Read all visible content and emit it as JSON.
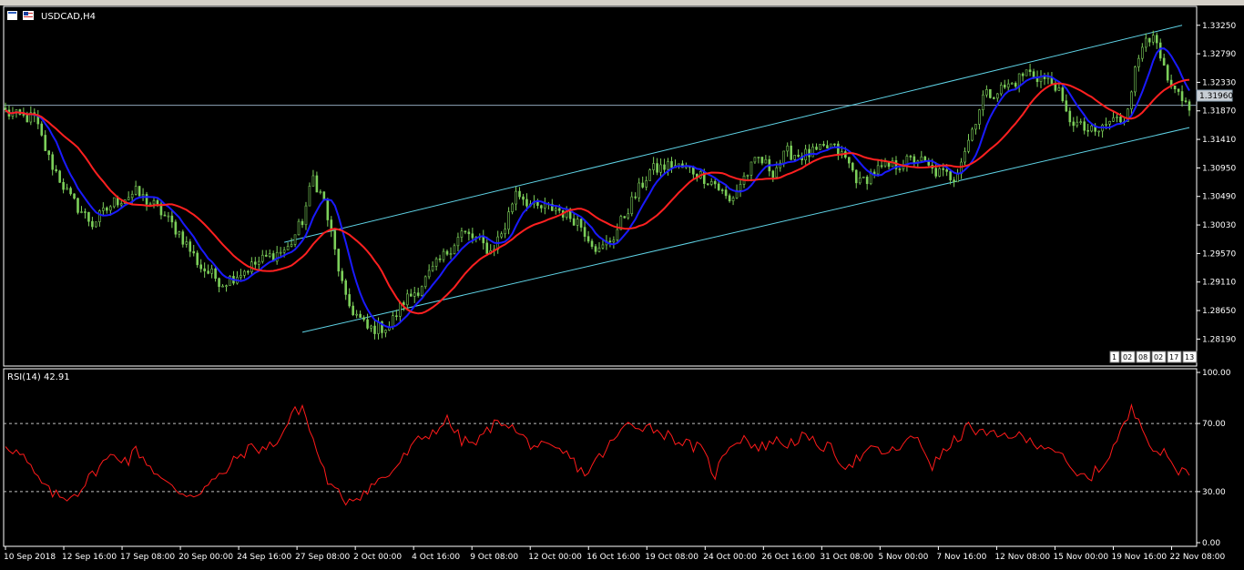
{
  "window": {
    "symbol_title": "USDCAD,H4",
    "current_price": "1.31960"
  },
  "indicator": {
    "title": "RSI(14) 42.91",
    "levels": [
      "100.00",
      "70.00",
      "30.00",
      "0.00"
    ]
  },
  "navigation_tabs": [
    "1",
    "02",
    "08",
    "02",
    "17",
    "13"
  ],
  "colors": {
    "background": "#000000",
    "candles": "#7ccf5a",
    "ma_fast": "#1a1aff",
    "ma_slow": "#ff2020",
    "channel": "#5fd3e6",
    "rsi": "#ff1a1a",
    "price_line": "#8fa6b8"
  },
  "chart_data": [
    {
      "type": "candlestick",
      "title": "USDCAD,H4",
      "y_ticks": [
        "1.33250",
        "1.32790",
        "1.32330",
        "1.31870",
        "1.31410",
        "1.30950",
        "1.30490",
        "1.30030",
        "1.29570",
        "1.29110",
        "1.28650",
        "1.28190"
      ],
      "ylim": [
        1.2777,
        1.3354
      ],
      "x_ticks": [
        "10 Sep 2018",
        "12 Sep 16:00",
        "17 Sep 08:00",
        "20 Sep 00:00",
        "24 Sep 16:00",
        "27 Sep 08:00",
        "2 Oct 00:00",
        "4 Oct 16:00",
        "9 Oct 08:00",
        "12 Oct 00:00",
        "16 Oct 16:00",
        "19 Oct 08:00",
        "24 Oct 00:00",
        "26 Oct 16:00",
        "31 Oct 08:00",
        "5 Nov 00:00",
        "7 Nov 16:00",
        "12 Nov 08:00",
        "15 Nov 00:00",
        "19 Nov 16:00",
        "22 Nov 08:00"
      ],
      "current_price": 1.3196,
      "price_anchors": [
        [
          0,
          1.3185
        ],
        [
          3,
          1.3178
        ],
        [
          8,
          1.3175
        ],
        [
          12,
          1.311
        ],
        [
          18,
          1.3045
        ],
        [
          24,
          1.3005
        ],
        [
          30,
          1.304
        ],
        [
          36,
          1.3055
        ],
        [
          42,
          1.303
        ],
        [
          48,
          1.299
        ],
        [
          54,
          1.2935
        ],
        [
          60,
          1.291
        ],
        [
          66,
          1.293
        ],
        [
          72,
          1.295
        ],
        [
          78,
          1.2965
        ],
        [
          82,
          1.301
        ],
        [
          85,
          1.308
        ],
        [
          88,
          1.304
        ],
        [
          91,
          1.296
        ],
        [
          94,
          1.288
        ],
        [
          100,
          1.2835
        ],
        [
          106,
          1.284
        ],
        [
          110,
          1.288
        ],
        [
          114,
          1.29
        ],
        [
          118,
          1.293
        ],
        [
          122,
          1.296
        ],
        [
          126,
          1.299
        ],
        [
          130,
          1.298
        ],
        [
          134,
          1.296
        ],
        [
          138,
          1.3
        ],
        [
          141,
          1.306
        ],
        [
          146,
          1.303
        ],
        [
          152,
          1.303
        ],
        [
          158,
          1.301
        ],
        [
          164,
          1.296
        ],
        [
          168,
          1.2985
        ],
        [
          172,
          1.303
        ],
        [
          178,
          1.309
        ],
        [
          184,
          1.31
        ],
        [
          190,
          1.309
        ],
        [
          196,
          1.307
        ],
        [
          200,
          1.304
        ],
        [
          204,
          1.308
        ],
        [
          208,
          1.311
        ],
        [
          212,
          1.309
        ],
        [
          216,
          1.312
        ],
        [
          220,
          1.3115
        ],
        [
          224,
          1.312
        ],
        [
          228,
          1.313
        ],
        [
          232,
          1.311
        ],
        [
          236,
          1.307
        ],
        [
          240,
          1.309
        ],
        [
          246,
          1.31
        ],
        [
          252,
          1.311
        ],
        [
          256,
          1.309
        ],
        [
          262,
          1.308
        ],
        [
          266,
          1.314
        ],
        [
          270,
          1.321
        ],
        [
          274,
          1.322
        ],
        [
          278,
          1.323
        ],
        [
          282,
          1.325
        ],
        [
          286,
          1.324
        ],
        [
          290,
          1.323
        ],
        [
          293,
          1.318
        ],
        [
          297,
          1.316
        ],
        [
          301,
          1.315
        ],
        [
          305,
          1.317
        ],
        [
          309,
          1.3175
        ],
        [
          312,
          1.325
        ],
        [
          315,
          1.3315
        ],
        [
          318,
          1.329
        ],
        [
          321,
          1.323
        ],
        [
          325,
          1.32
        ],
        [
          327,
          1.3196
        ]
      ],
      "series": [
        {
          "name": "",
          "kind": "moving_average",
          "period": 8,
          "color": "#1a1aff"
        },
        {
          "name": "",
          "kind": "moving_average",
          "period": 21,
          "color": "#ff2020"
        }
      ],
      "channel": {
        "upper": {
          "start_bar": 77,
          "start_price": 1.2975,
          "end_bar": 325,
          "end_price": 1.3325
        },
        "lower": {
          "start_bar": 82,
          "start_price": 1.283,
          "end_bar": 327,
          "end_price": 1.316
        }
      }
    },
    {
      "type": "line",
      "title": "RSI(14) 42.91",
      "ylim": [
        0,
        100
      ],
      "y_ticks": [
        "100.00",
        "70.00",
        "30.00",
        "0.00"
      ],
      "levels": [
        70,
        30
      ],
      "series": [
        {
          "name": "",
          "color": "#ff1a1a",
          "anchors": [
            [
              0,
              58
            ],
            [
              5,
              50
            ],
            [
              8,
              40
            ],
            [
              12,
              30
            ],
            [
              16,
              26
            ],
            [
              20,
              30
            ],
            [
              26,
              45
            ],
            [
              30,
              52
            ],
            [
              34,
              48
            ],
            [
              36,
              55
            ],
            [
              40,
              45
            ],
            [
              44,
              35
            ],
            [
              48,
              30
            ],
            [
              52,
              28
            ],
            [
              56,
              34
            ],
            [
              60,
              40
            ],
            [
              64,
              50
            ],
            [
              68,
              56
            ],
            [
              72,
              55
            ],
            [
              76,
              62
            ],
            [
              79,
              75
            ],
            [
              82,
              80
            ],
            [
              85,
              60
            ],
            [
              88,
              42
            ],
            [
              90,
              32
            ],
            [
              94,
              25
            ],
            [
              98,
              28
            ],
            [
              102,
              35
            ],
            [
              106,
              40
            ],
            [
              110,
              50
            ],
            [
              114,
              60
            ],
            [
              118,
              65
            ],
            [
              122,
              72
            ],
            [
              126,
              60
            ],
            [
              130,
              58
            ],
            [
              134,
              68
            ],
            [
              138,
              72
            ],
            [
              141,
              65
            ],
            [
              145,
              58
            ],
            [
              150,
              55
            ],
            [
              155,
              52
            ],
            [
              160,
              40
            ],
            [
              164,
              50
            ],
            [
              168,
              60
            ],
            [
              172,
              70
            ],
            [
              178,
              68
            ],
            [
              184,
              62
            ],
            [
              188,
              58
            ],
            [
              192,
              55
            ],
            [
              196,
              40
            ],
            [
              200,
              58
            ],
            [
              204,
              62
            ],
            [
              208,
              55
            ],
            [
              212,
              60
            ],
            [
              216,
              58
            ],
            [
              220,
              62
            ],
            [
              224,
              58
            ],
            [
              228,
              55
            ],
            [
              232,
              45
            ],
            [
              236,
              50
            ],
            [
              240,
              55
            ],
            [
              244,
              52
            ],
            [
              248,
              58
            ],
            [
              252,
              62
            ],
            [
              256,
              45
            ],
            [
              260,
              55
            ],
            [
              266,
              68
            ],
            [
              270,
              64
            ],
            [
              274,
              62
            ],
            [
              278,
              64
            ],
            [
              282,
              60
            ],
            [
              286,
              58
            ],
            [
              290,
              55
            ],
            [
              295,
              40
            ],
            [
              299,
              38
            ],
            [
              303,
              45
            ],
            [
              307,
              60
            ],
            [
              311,
              78
            ],
            [
              314,
              70
            ],
            [
              317,
              55
            ],
            [
              320,
              52
            ],
            [
              324,
              42
            ],
            [
              327,
              43
            ]
          ]
        }
      ]
    }
  ]
}
